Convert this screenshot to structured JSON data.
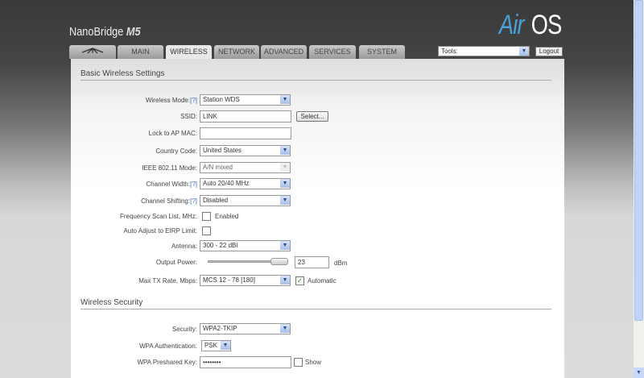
{
  "header": {
    "product": "NanoBridge",
    "model": "M5",
    "logo_air": "Air",
    "logo_os": "OS"
  },
  "tabs": [
    {
      "label": ""
    },
    {
      "label": "MAIN"
    },
    {
      "label": "WIRELESS"
    },
    {
      "label": "NETWORK"
    },
    {
      "label": "ADVANCED"
    },
    {
      "label": "SERVICES"
    },
    {
      "label": "SYSTEM"
    }
  ],
  "tools": {
    "value": "Tools:",
    "logout": "Logout"
  },
  "basic": {
    "title": "Basic Wireless Settings",
    "wireless_mode": {
      "label": "Wireless Mode:",
      "help": "[?]",
      "value": "Station WDS"
    },
    "ssid": {
      "label": "SSID:",
      "value": "LINK",
      "button": "Select..."
    },
    "lock_mac": {
      "label": "Lock to AP MAC:",
      "value": ""
    },
    "country": {
      "label": "Country Code:",
      "value": "United States"
    },
    "ieee_mode": {
      "label": "IEEE 802.11 Mode:",
      "value": "A/N mixed"
    },
    "channel_width": {
      "label": "Channel Width:",
      "help": "[?]",
      "value": "Auto 20/40 MHz"
    },
    "channel_shifting": {
      "label": "Channel Shifting:",
      "help": "[?]",
      "value": "Disabled"
    },
    "freq_scan": {
      "label": "Frequency Scan List, MHz:",
      "checkbox_label": "Enabled",
      "checked": false
    },
    "eirp": {
      "label": "Auto Adjust to EIRP Limit:",
      "checked": false
    },
    "antenna": {
      "label": "Antenna:",
      "value": "300 - 22 dBi"
    },
    "output_power": {
      "label": "Output Power:",
      "value": "23",
      "unit": "dBm",
      "slider_fraction": 1.0
    },
    "max_tx": {
      "label": "Max TX Rate, Mbps:",
      "value": "MCS 12 - 78 [180]",
      "automatic_label": "Automatic",
      "automatic": true
    }
  },
  "security": {
    "title": "Wireless Security",
    "security": {
      "label": "Security:",
      "value": "WPA2-TKIP"
    },
    "wpa_auth": {
      "label": "WPA Authentication:",
      "value": "PSK"
    },
    "psk": {
      "label": "WPA Preshared Key:",
      "value": "••••••••",
      "show_label": "Show",
      "show": false
    }
  }
}
